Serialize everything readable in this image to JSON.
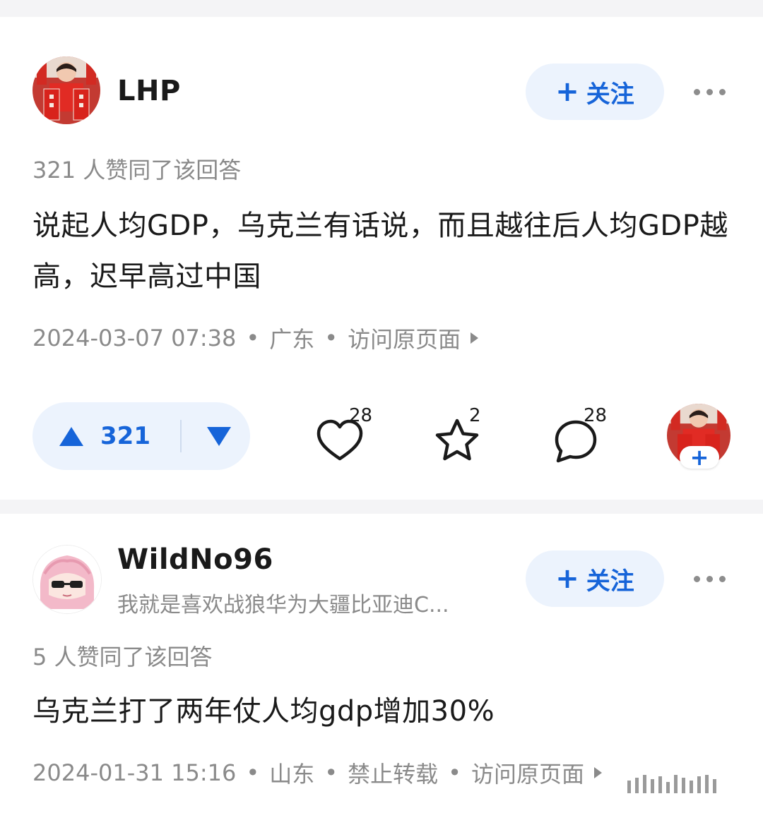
{
  "answers": [
    {
      "author": {
        "name": "LHP"
      },
      "follow_label": "关注",
      "vote_summary": "321 人赞同了该回答",
      "content": "说起人均GDP，乌克兰有话说，而且越往后人均GDP越高，迟早高过中国",
      "meta": {
        "datetime": "2024-03-07 07:38",
        "location": "广东",
        "link": "访问原页面"
      },
      "actions": {
        "upvotes": "321",
        "likes": "28",
        "favorites": "2",
        "comments": "28"
      }
    },
    {
      "author": {
        "name": "WildNo96",
        "bio": "我就是喜欢战狼华为大疆比亚迪C..."
      },
      "follow_label": "关注",
      "vote_summary": "5 人赞同了该回答",
      "content": "乌克兰打了两年仗人均gdp增加30%",
      "meta": {
        "datetime": "2024-01-31 15:16",
        "location": "山东",
        "note": "禁止转载",
        "link": "访问原页面"
      }
    }
  ],
  "colors": {
    "accent": "#1664d9",
    "accent_bg": "#ecf3fd",
    "muted_text": "#8a8a8a",
    "separator": "#f4f4f6"
  }
}
